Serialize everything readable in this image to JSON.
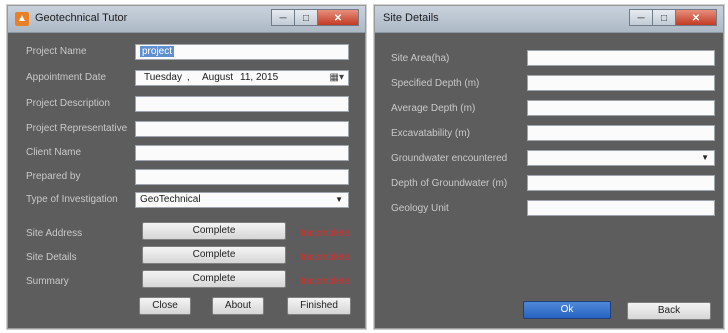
{
  "left_window": {
    "title": "Geotechnical Tutor",
    "caption": {
      "minimize": "─",
      "maximize": "□",
      "close": "✕"
    },
    "fields": [
      {
        "label": "Project Name",
        "value": "project"
      },
      {
        "label": "Appointment Date",
        "date": {
          "day": "Tuesday",
          "sep": ",",
          "month": "August",
          "dom": "11, 2015"
        }
      },
      {
        "label": "Project Description",
        "value": ""
      },
      {
        "label": "Project Representative",
        "value": ""
      },
      {
        "label": "Client Name",
        "value": ""
      },
      {
        "label": "Prepared by",
        "value": ""
      },
      {
        "label": "Type of Investigation",
        "value": "GeoTechnical"
      }
    ],
    "sections": [
      {
        "label": "Site Address",
        "button": "Complete",
        "status": "Incomplete"
      },
      {
        "label": "Site Details",
        "button": "Complete",
        "status": "Incomplete"
      },
      {
        "label": "Summary",
        "button": "Complete",
        "status": "Incomplete"
      }
    ],
    "footer": {
      "close": "Close",
      "about": "About",
      "finished": "Finished"
    }
  },
  "right_window": {
    "title": "Site Details",
    "caption": {
      "minimize": "─",
      "maximize": "□",
      "close": "✕"
    },
    "fields": [
      {
        "label": "Site Area(ha)",
        "value": ""
      },
      {
        "label": "Specified Depth (m)",
        "value": ""
      },
      {
        "label": "Average Depth (m)",
        "value": ""
      },
      {
        "label": "Excavatability (m)",
        "value": ""
      },
      {
        "label": "Groundwater encountered",
        "value": ""
      },
      {
        "label": "Depth of Groundwater (m)",
        "value": ""
      },
      {
        "label": "Geology Unit",
        "value": ""
      }
    ],
    "footer": {
      "ok": "Ok",
      "back": "Back"
    }
  },
  "colors": {
    "status_red": "#d33030",
    "primary_blue": "#2763c2",
    "window_bg": "#5d5d5d"
  }
}
